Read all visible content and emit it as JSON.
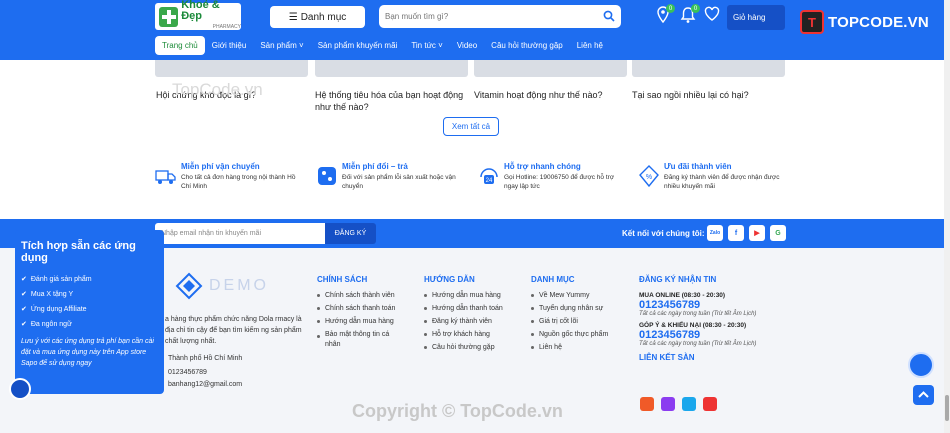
{
  "header": {
    "logo_text": "Khoẻ & Đẹp",
    "logo_sub": "PHARMACY",
    "category_button": "Danh mục",
    "search_placeholder": "Bạn muốn tìm gì?",
    "notif_count": "0",
    "cart_label": "Giỏ hàng",
    "brand_name": "TOPCODE.VN",
    "brand_mark": "T"
  },
  "nav": [
    "Trang chủ",
    "Giới thiệu",
    "Sản phẩm",
    "Sản phẩm khuyến mãi",
    "Tin tức",
    "Video",
    "Câu hỏi thường gặp",
    "Liên hệ"
  ],
  "articles": [
    "Hội chứng khó đọc là gì?",
    "Hệ thống tiêu hóa của bạn hoạt động như thế nào?",
    "Vitamin hoạt động như thế nào?",
    "Tại sao ngồi nhiều lại có hại?"
  ],
  "see_all": "Xem tất cả",
  "features": [
    {
      "title": "Miễn phí vận chuyển",
      "desc": "Cho tất cả đơn hàng trong nội thành Hồ Chí Minh"
    },
    {
      "title": "Miễn phí đổi – trả",
      "desc": "Đối với sản phẩm lỗi sản xuất hoặc vận chuyển"
    },
    {
      "title": "Hỗ trợ nhanh chóng",
      "desc": "Gọi Hotline: 19006750 để được hỗ trợ ngay lập tức"
    },
    {
      "title": "Ưu đãi thành viên",
      "desc": "Đăng ký thành viên để được nhận được nhiều khuyến mãi"
    }
  ],
  "newsletter": {
    "placeholder": "Nhập email nhận tin khuyến mãi",
    "button": "ĐĂNG KÝ",
    "connect": "Kết nối với chúng tôi:"
  },
  "social": [
    "Zalo",
    "f",
    "▶",
    "G"
  ],
  "footer": {
    "brand": "DEMO",
    "about": "a hàng thực phẩm chức năng Dola rmacy là địa chỉ tin cậy để bạn tìm kiếm ng sản phẩm chất lượng nhất.",
    "address": "Thành phố Hồ Chí Minh",
    "phone": "0123456789",
    "email": "banhang12@gmail.com",
    "cols": [
      {
        "title": "CHÍNH SÁCH",
        "items": [
          "Chính sách thành viên",
          "Chính sách thanh toán",
          "Hướng dẫn mua hàng",
          "Bảo mật thông tin cá nhân"
        ]
      },
      {
        "title": "HƯỚNG DẪN",
        "items": [
          "Hướng dẫn mua hàng",
          "Hướng dẫn thanh toán",
          "Đăng ký thành viên",
          "Hỗ trợ khách hàng",
          "Câu hỏi thường gặp"
        ]
      },
      {
        "title": "DANH MỤC",
        "items": [
          "Về Mew Yummy",
          "Tuyển dụng nhân sự",
          "Giá trị cốt lõi",
          "Nguồn gốc thực phẩm",
          "Liên hệ"
        ]
      }
    ],
    "subscribe": {
      "title": "ĐĂNG KÝ NHẬN TIN",
      "buy_label": "MUA ONLINE (08:30 - 20:30)",
      "buy_phone": "0123456789",
      "buy_note": "Tất cả các ngày trong tuần (Trừ tết Âm Lịch)",
      "fb_label": "GÓP Ý & KHIẾU NẠI (08:30 - 20:30)",
      "fb_phone": "0123456789",
      "fb_note": "Tất cả các ngày trong tuần (Trừ tết Âm Lịch)",
      "stores_title": "LIÊN KẾT SÀN"
    }
  },
  "popup": {
    "title": "Tích hợp sẵn các ứng dụng",
    "items": [
      "Đánh giá sản phẩm",
      "Mua X tặng Y",
      "Ứng dụng Affiliate",
      "Đa ngôn ngữ"
    ],
    "note": "Lưu ý với các ứng dụng trả phí bạn cần cài đặt và mua ứng dụng này trên App store Sapo để sử dụng ngay"
  },
  "watermark": "Copyright © TopCode.vn",
  "watermark2": "TopCode.vn"
}
